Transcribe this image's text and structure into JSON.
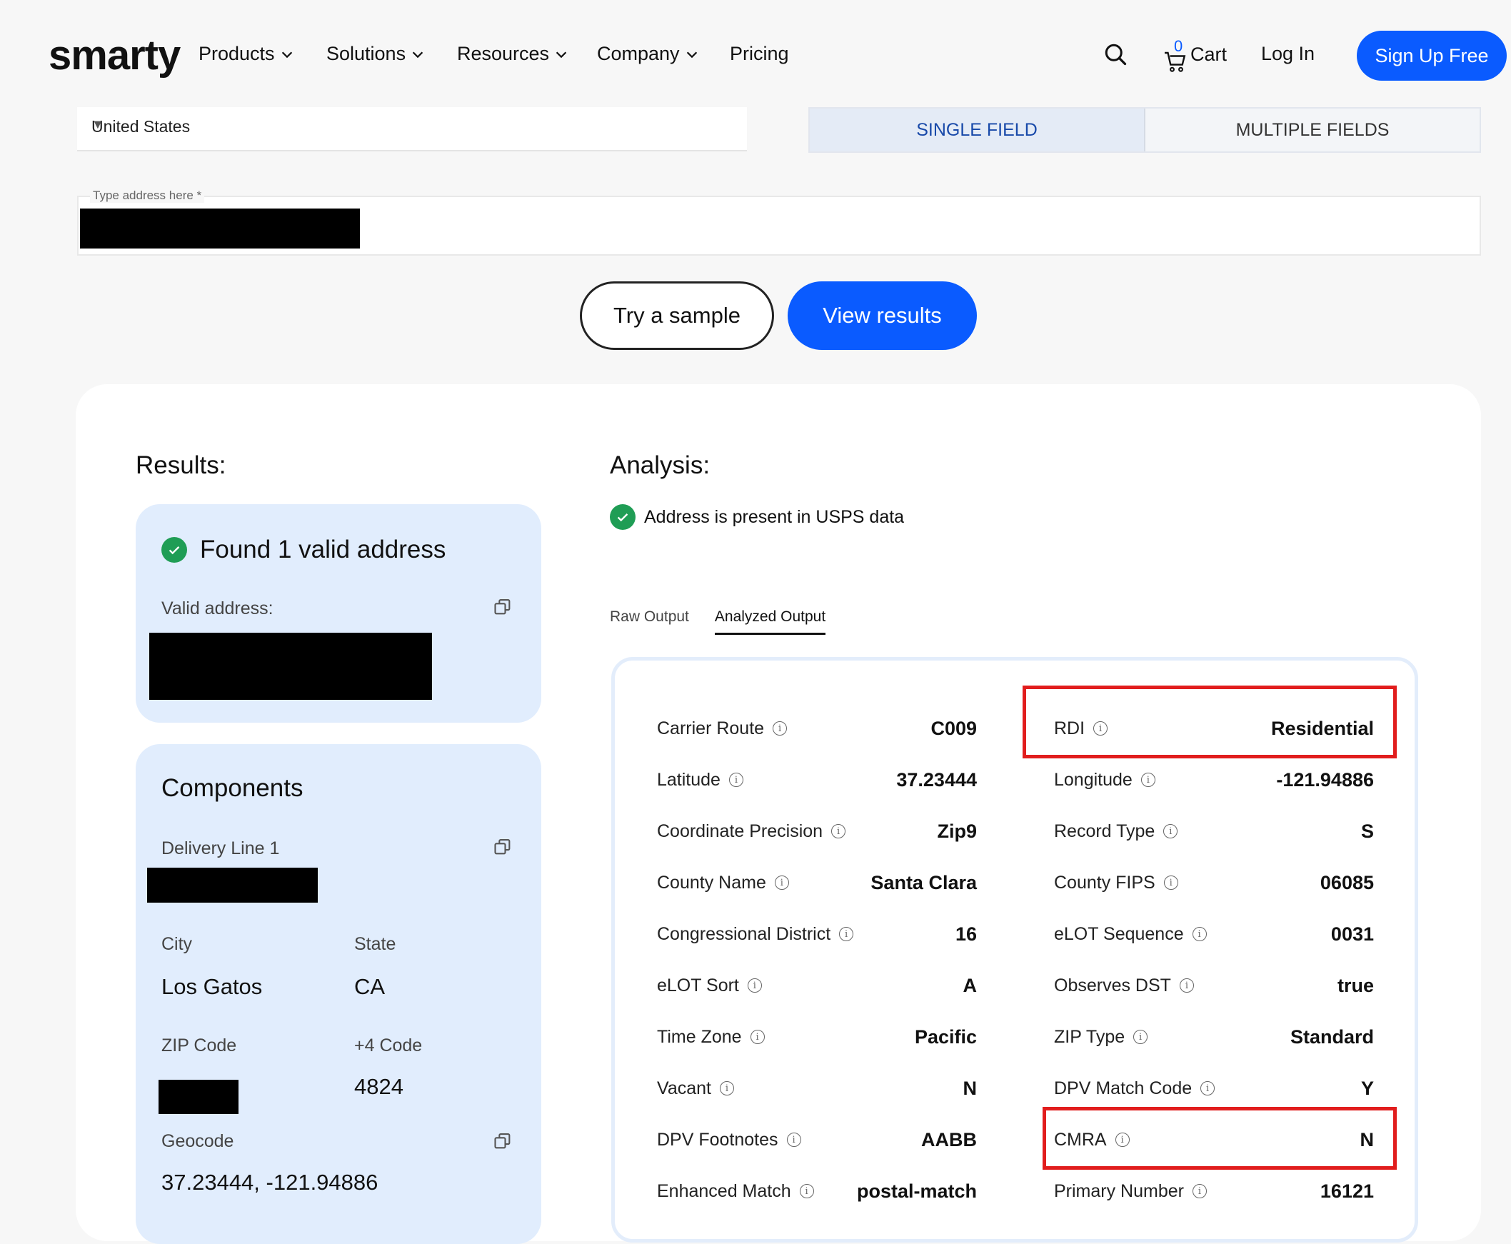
{
  "header": {
    "logo_text": "smarty",
    "nav": [
      "Products",
      "Solutions",
      "Resources",
      "Company"
    ],
    "pricing": "Pricing",
    "cart_count": "0",
    "cart_label": "Cart",
    "login": "Log In",
    "signup": "Sign Up Free"
  },
  "search": {
    "country": "United States",
    "mode_single": "SINGLE FIELD",
    "mode_multiple": "MULTIPLE FIELDS",
    "address_label": "Type address here *",
    "try_sample": "Try a sample",
    "view_results": "View results"
  },
  "results": {
    "heading": "Results:",
    "found": "Found 1 valid address",
    "valid_label": "Valid address:",
    "components_title": "Components",
    "delivery_line_label": "Delivery Line 1",
    "city_label": "City",
    "city": "Los Gatos",
    "state_label": "State",
    "state": "CA",
    "zip_label": "ZIP Code",
    "plus4_label": "+4 Code",
    "plus4": "4824",
    "geocode_label": "Geocode",
    "geocode": "37.23444, -121.94886"
  },
  "analysis": {
    "heading": "Analysis:",
    "usps_status": "Address is present in USPS data",
    "tab_raw": "Raw Output",
    "tab_analyzed": "Analyzed Output",
    "left_rows": [
      {
        "k": "Carrier Route",
        "v": "C009"
      },
      {
        "k": "Latitude",
        "v": "37.23444"
      },
      {
        "k": "Coordinate Precision",
        "v": "Zip9"
      },
      {
        "k": "County Name",
        "v": "Santa Clara"
      },
      {
        "k": "Congressional District",
        "v": "16"
      },
      {
        "k": "eLOT Sort",
        "v": "A"
      },
      {
        "k": "Time Zone",
        "v": "Pacific"
      },
      {
        "k": "Vacant",
        "v": "N"
      },
      {
        "k": "DPV Footnotes",
        "v": "AABB"
      },
      {
        "k": "Enhanced Match",
        "v": "postal-match"
      }
    ],
    "right_rows": [
      {
        "k": "RDI",
        "v": "Residential"
      },
      {
        "k": "Longitude",
        "v": "-121.94886"
      },
      {
        "k": "Record Type",
        "v": "S"
      },
      {
        "k": "County FIPS",
        "v": "06085"
      },
      {
        "k": "eLOT Sequence",
        "v": "0031"
      },
      {
        "k": "Observes DST",
        "v": "true"
      },
      {
        "k": "ZIP Type",
        "v": "Standard"
      },
      {
        "k": "DPV Match Code",
        "v": "Y"
      },
      {
        "k": "CMRA",
        "v": "N"
      },
      {
        "k": "Primary Number",
        "v": "16121"
      }
    ],
    "info_glyph": "i"
  },
  "colors": {
    "brand_blue": "#0a5bff",
    "highlight_red": "#e11d1d",
    "panel_bg": "#e1edfd",
    "check_green": "#1f9d55"
  }
}
